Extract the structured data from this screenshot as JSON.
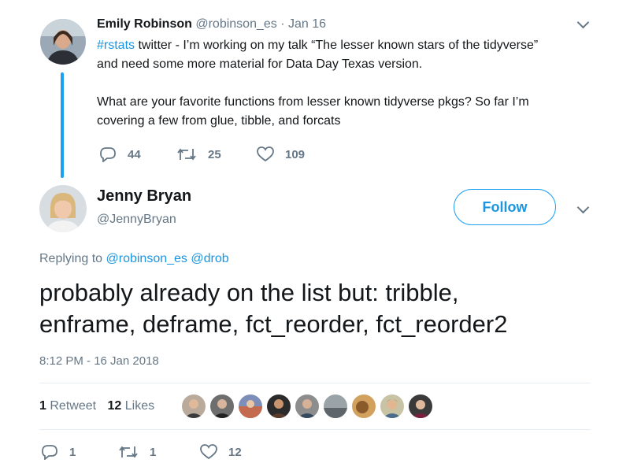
{
  "parent_tweet": {
    "author_name": "Emily Robinson",
    "author_handle": "@robinson_es",
    "separator": "·",
    "date": "Jan 16",
    "hashtag": "#rstats",
    "text_line1": " twitter - I’m working on my talk “The lesser known stars of the tidyverse”",
    "text_line2": "and need some more material for Data Day Texas version.",
    "text_line3": "What are your favorite functions from lesser known tidyverse pkgs? So far I’m",
    "text_line4": "covering a few from glue, tibble, and forcats",
    "reply_count": "44",
    "retweet_count": "25",
    "like_count": "109"
  },
  "main_tweet": {
    "author_name": "Jenny Bryan",
    "author_handle": "@JennyBryan",
    "follow_label": "Follow",
    "replying_prefix": "Replying to ",
    "reply_to_1": "@robinson_es",
    "reply_to_2": "@drob",
    "text_line1": "probably already on the list but: tribble,",
    "text_line2": "enframe, deframe, fct_reorder, fct_reorder2",
    "timestamp": "8:12 PM - 16 Jan 2018",
    "retweets_num": "1",
    "retweets_label": "Retweet",
    "likes_num": "12",
    "likes_label": "Likes",
    "reply_count": "1",
    "retweet_count": "1",
    "like_count": "12"
  },
  "colors": {
    "accent": "#1da1f2",
    "link": "#1b95e0",
    "secondary_text": "#657786"
  }
}
